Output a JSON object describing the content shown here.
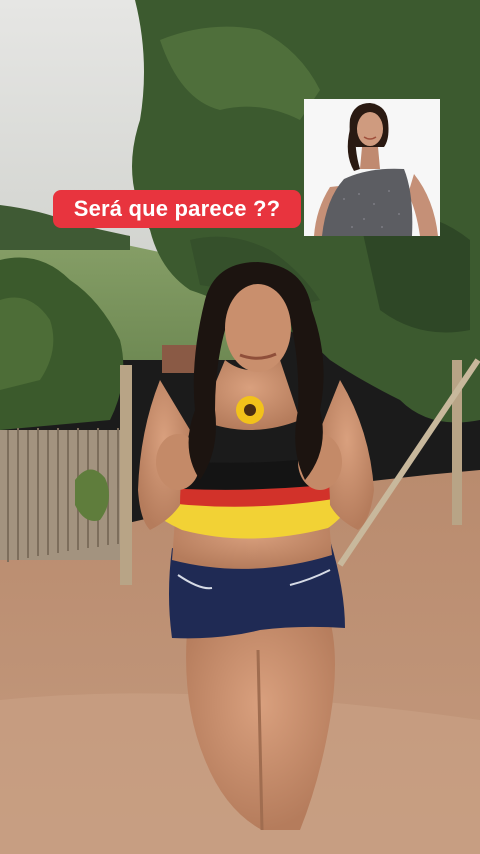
{
  "caption": {
    "text": "Será que parece ??",
    "background_color": "#e8343e",
    "text_color": "#ffffff"
  },
  "inset_photo": {
    "subject": "comparison-photo"
  },
  "video_frame": {
    "subject": "dancer-outdoor-video"
  }
}
